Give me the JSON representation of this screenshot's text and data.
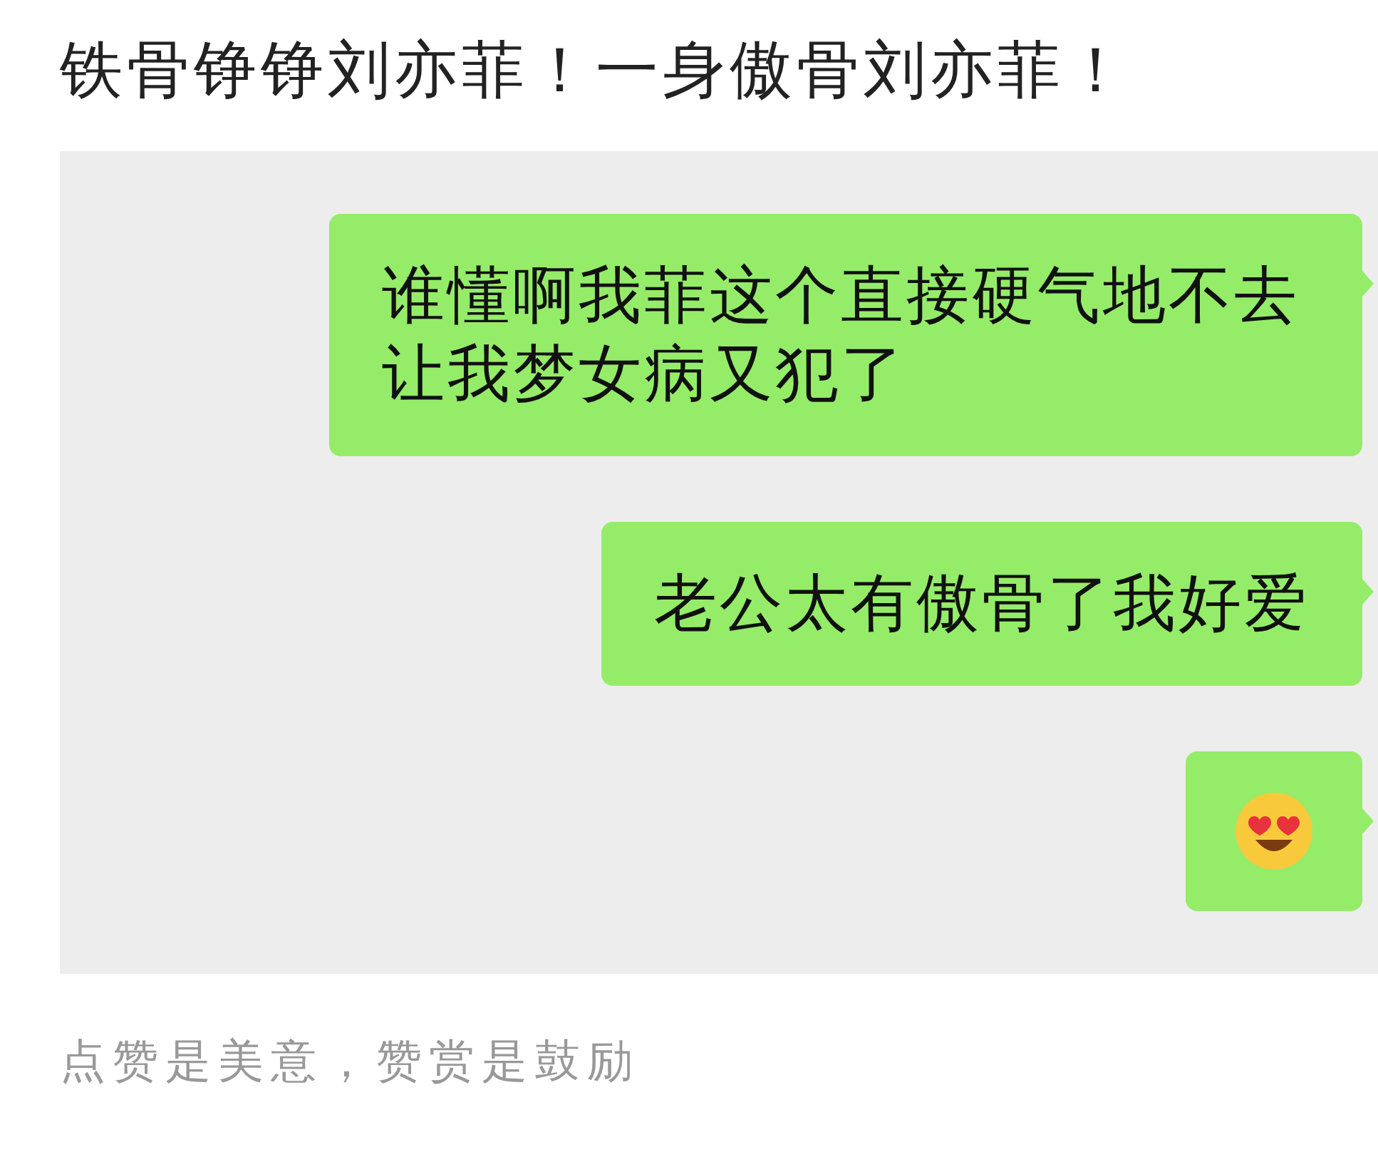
{
  "post": {
    "title": "铁骨铮铮刘亦菲！一身傲骨刘亦菲！"
  },
  "chat": {
    "messages": [
      {
        "kind": "text",
        "text": "谁懂啊我菲这个直接硬气地不去让我梦女病又犯了"
      },
      {
        "kind": "text",
        "text": "老公太有傲骨了我好爱"
      },
      {
        "kind": "emoji"
      }
    ]
  },
  "footer": {
    "text": "点赞是美意，赞赏是鼓励"
  }
}
